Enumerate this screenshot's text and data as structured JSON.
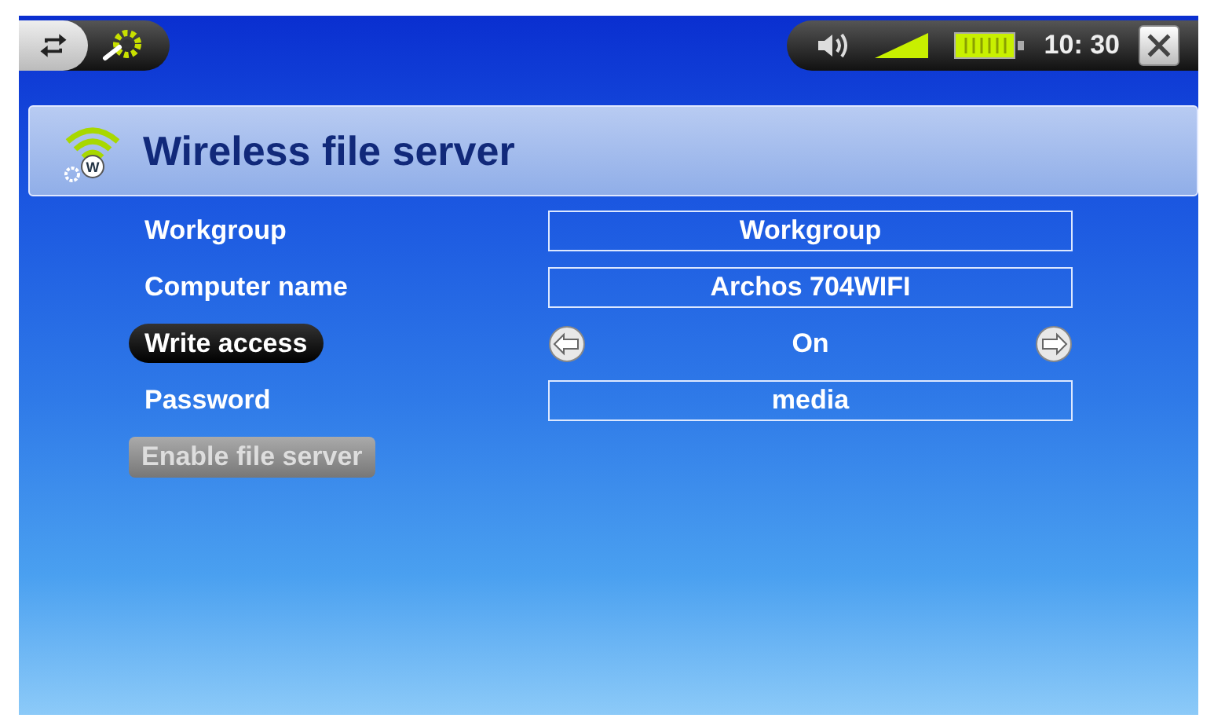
{
  "status_bar": {
    "time": "10: 30"
  },
  "header": {
    "icon_letter": "W",
    "title": "Wireless file server"
  },
  "rows": [
    {
      "kind": "field",
      "label": "Workgroup",
      "value": "Workgroup",
      "selected": false
    },
    {
      "kind": "field",
      "label": "Computer name",
      "value": "Archos 704WIFI",
      "selected": false
    },
    {
      "kind": "selector",
      "label": "Write access",
      "value": "On",
      "selected": true
    },
    {
      "kind": "field",
      "label": "Password",
      "value": "media",
      "selected": false
    }
  ],
  "button": {
    "label": "Enable file server",
    "disabled": true
  }
}
